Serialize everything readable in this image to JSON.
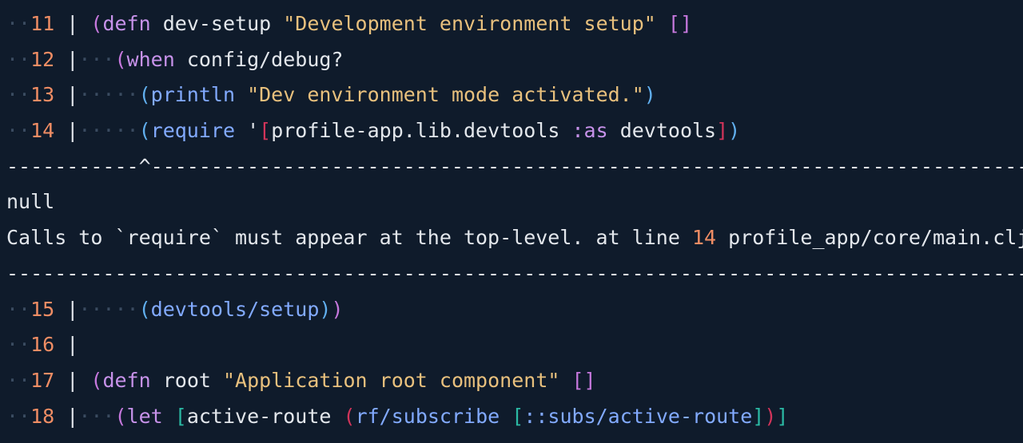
{
  "colors": {
    "background": "#0f1b2b",
    "text": "#e3e7ec",
    "line_number": "#f08d64",
    "string": "#e8c07d",
    "keyword": "#c792ea",
    "function": "#82aaff",
    "paren_depth_1": "#c678dd",
    "paren_depth_2": "#61afef",
    "bracket_red": "#d1345a",
    "bracket_teal": "#2bb9a4",
    "whitespace_dots": "#3a4b60"
  },
  "code": [
    {
      "number": "11",
      "tokens": [
        {
          "t": " ",
          "c": "sym"
        },
        {
          "t": "(",
          "c": "p1"
        },
        {
          "t": "defn",
          "c": "kw"
        },
        {
          "t": " dev-setup ",
          "c": "def"
        },
        {
          "t": "\"Development environment setup\"",
          "c": "str"
        },
        {
          "t": " ",
          "c": "sym"
        },
        {
          "t": "[]",
          "c": "p1"
        }
      ]
    },
    {
      "number": "12",
      "tokens": [
        {
          "t": "···",
          "c": "ws"
        },
        {
          "t": "(",
          "c": "p1"
        },
        {
          "t": "when",
          "c": "kw"
        },
        {
          "t": " config/debug?",
          "c": "sym"
        }
      ]
    },
    {
      "number": "13",
      "tokens": [
        {
          "t": "·····",
          "c": "ws"
        },
        {
          "t": "(",
          "c": "p2"
        },
        {
          "t": "println",
          "c": "fn"
        },
        {
          "t": " ",
          "c": "sym"
        },
        {
          "t": "\"Dev environment mode activated.\"",
          "c": "str"
        },
        {
          "t": ")",
          "c": "p2"
        }
      ]
    },
    {
      "number": "14",
      "tokens": [
        {
          "t": "·····",
          "c": "ws"
        },
        {
          "t": "(",
          "c": "p2"
        },
        {
          "t": "require",
          "c": "fn"
        },
        {
          "t": " '",
          "c": "sym"
        },
        {
          "t": "[",
          "c": "p3"
        },
        {
          "t": "profile-app.lib.devtools ",
          "c": "sym"
        },
        {
          "t": ":as",
          "c": "kwd"
        },
        {
          "t": " devtools",
          "c": "sym"
        },
        {
          "t": "]",
          "c": "p3"
        },
        {
          "t": ")",
          "c": "p2"
        }
      ]
    }
  ],
  "caret_rule": "-----------^-------------------------------------------------------------------------",
  "error": {
    "value": "null",
    "message_prefix": "Calls to `require` must appear at the top-level. at line ",
    "line": "14",
    "file": " profile_app/core/main.cljs"
  },
  "bottom_rule": "-----------------------------------------------------------------------------------------",
  "code_after": [
    {
      "number": "15",
      "tokens": [
        {
          "t": "·····",
          "c": "ws"
        },
        {
          "t": "(",
          "c": "p2"
        },
        {
          "t": "devtools/setup",
          "c": "fn"
        },
        {
          "t": ")",
          "c": "p2"
        },
        {
          "t": ")",
          "c": "p1"
        }
      ]
    },
    {
      "number": "16",
      "tokens": []
    },
    {
      "number": "17",
      "tokens": [
        {
          "t": " ",
          "c": "sym"
        },
        {
          "t": "(",
          "c": "p1"
        },
        {
          "t": "defn",
          "c": "kw"
        },
        {
          "t": " root ",
          "c": "def"
        },
        {
          "t": "\"Application root component\"",
          "c": "str"
        },
        {
          "t": " ",
          "c": "sym"
        },
        {
          "t": "[]",
          "c": "p1"
        }
      ]
    },
    {
      "number": "18",
      "tokens": [
        {
          "t": "···",
          "c": "ws"
        },
        {
          "t": "(",
          "c": "p1"
        },
        {
          "t": "let",
          "c": "kw"
        },
        {
          "t": " ",
          "c": "sym"
        },
        {
          "t": "[",
          "c": "p4"
        },
        {
          "t": "active-route ",
          "c": "sym"
        },
        {
          "t": "(",
          "c": "p3"
        },
        {
          "t": "rf/subscribe",
          "c": "fn"
        },
        {
          "t": " ",
          "c": "sym"
        },
        {
          "t": "[",
          "c": "p4"
        },
        {
          "t": "::subs/active-route",
          "c": "fn"
        },
        {
          "t": "]",
          "c": "p4"
        },
        {
          "t": ")",
          "c": "p3"
        },
        {
          "t": "]",
          "c": "p4"
        }
      ]
    }
  ],
  "gutter_prefix": "··",
  "gutter_separator": " |"
}
